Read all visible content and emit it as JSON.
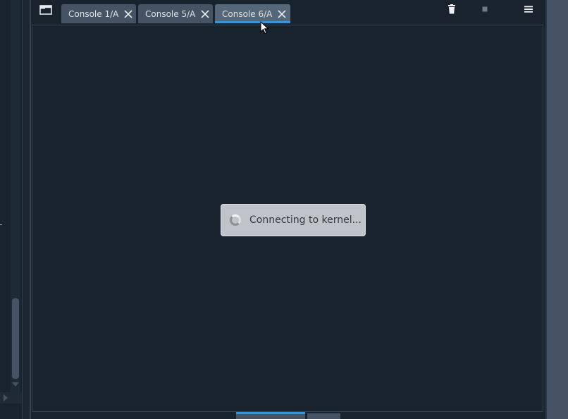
{
  "tabs": [
    {
      "label": "Console 1/A",
      "active": false
    },
    {
      "label": "Console 5/A",
      "active": false
    },
    {
      "label": "Console 6/A",
      "active": true
    }
  ],
  "toolbar": {
    "browse_tabs_icon": "browse-tabs-icon",
    "clear_icon": "trash-icon",
    "stop_icon": "stop-icon",
    "options_icon": "hamburger-menu-icon"
  },
  "console": {
    "loading_text": "Connecting to kernel..."
  },
  "colors": {
    "background": "#19232d",
    "tab": "#455364",
    "tab_active": "#54687a",
    "accent": "#259ae9",
    "dialog": "#bfc4c9"
  }
}
